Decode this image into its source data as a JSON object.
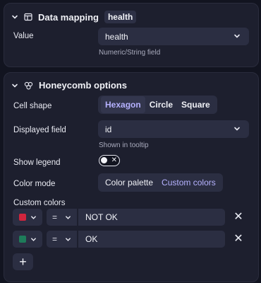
{
  "data_mapping": {
    "title": "Data mapping",
    "tag": "health",
    "value_label": "Value",
    "value_selected": "health",
    "value_hint": "Numeric/String field"
  },
  "honeycomb": {
    "title": "Honeycomb options",
    "cell_shape_label": "Cell shape",
    "cell_shapes": [
      "Hexagon",
      "Circle",
      "Square"
    ],
    "cell_shape_selected": "Hexagon",
    "displayed_field_label": "Displayed field",
    "displayed_field_selected": "id",
    "displayed_field_hint": "Shown in tooltip",
    "show_legend_label": "Show legend",
    "show_legend_enabled": false,
    "color_mode_label": "Color mode",
    "color_modes": [
      "Color palette",
      "Custom colors"
    ],
    "color_mode_selected": "Custom colors",
    "custom_colors_label": "Custom colors",
    "rules": [
      {
        "color": "#d0253d",
        "operator": "=",
        "value": "NOT OK"
      },
      {
        "color": "#1e7c5a",
        "operator": "=",
        "value": "OK"
      }
    ],
    "add_label": "+"
  },
  "colors": {
    "background": "#121420",
    "panel": "#1d1f2e",
    "control": "#2b2e42",
    "accent": "#b6b2ff"
  }
}
